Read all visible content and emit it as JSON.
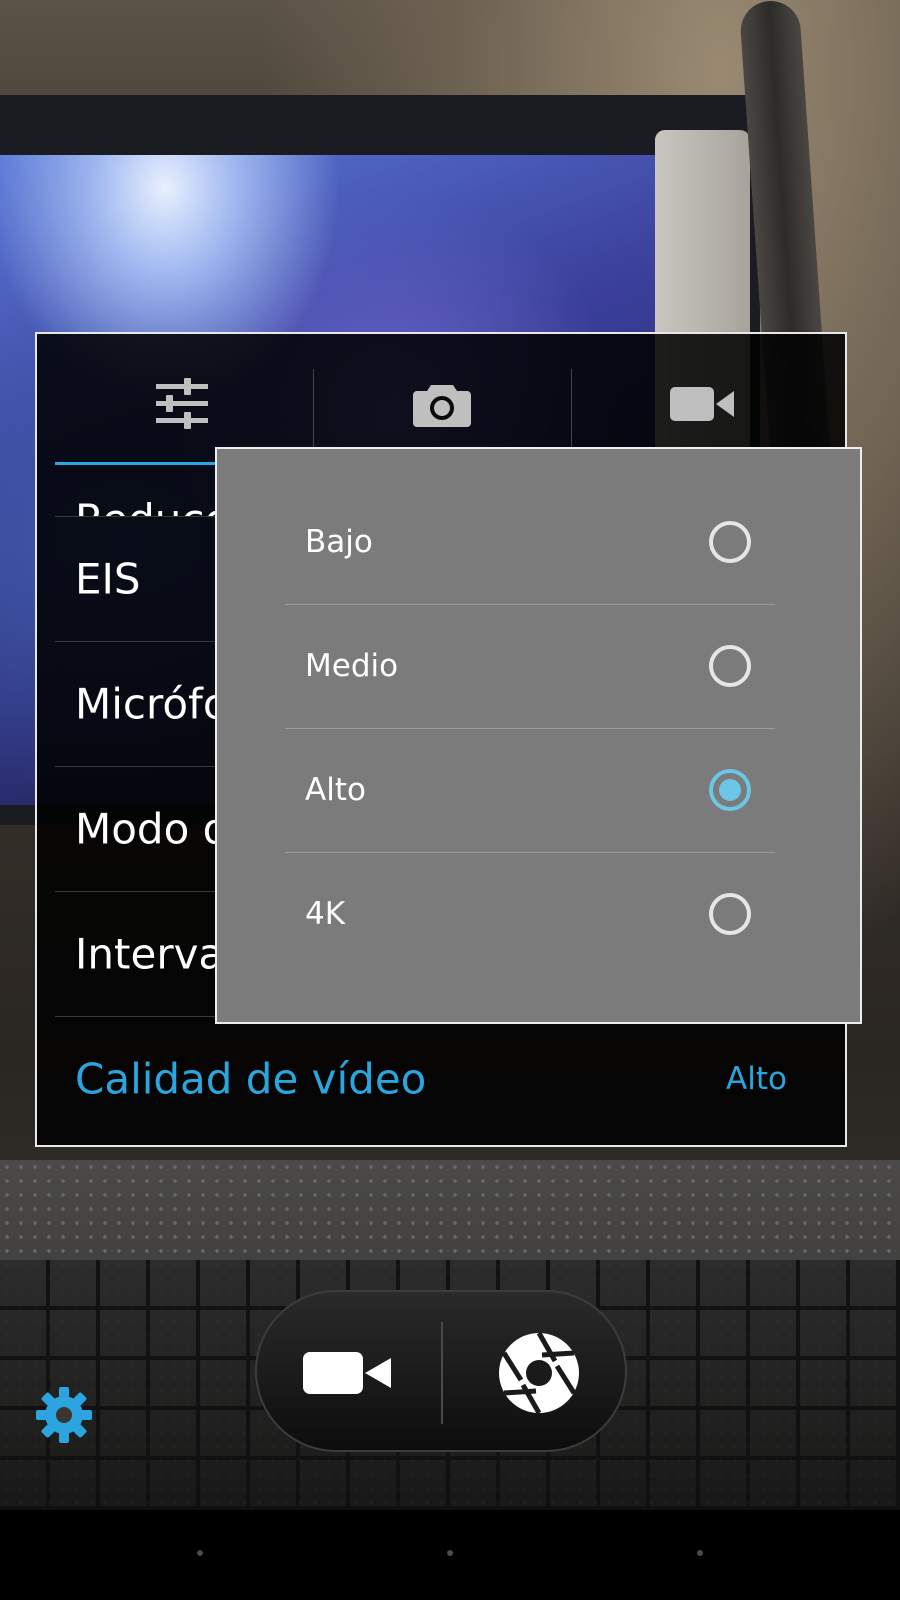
{
  "settings": {
    "tabs": [
      {
        "icon": "sliders-icon"
      },
      {
        "icon": "camera-icon"
      },
      {
        "icon": "video-camera-icon"
      }
    ],
    "items": [
      {
        "label": "Reducc"
      },
      {
        "label": "EIS"
      },
      {
        "label": "Micrófo"
      },
      {
        "label": "Modo d"
      },
      {
        "label": "Interval"
      }
    ],
    "active_item": {
      "label": "Calidad de vídeo",
      "value": "Alto"
    }
  },
  "quality_dialog": {
    "options": [
      {
        "label": "Bajo",
        "selected": false
      },
      {
        "label": "Medio",
        "selected": false
      },
      {
        "label": "Alto",
        "selected": true
      },
      {
        "label": "4K",
        "selected": false
      }
    ]
  },
  "controls": {
    "video_icon": "video-camera-icon",
    "shutter_icon": "shutter-icon",
    "settings_icon": "gear-icon"
  },
  "colors": {
    "accent": "#29a6de",
    "radio_selected": "#6cc6e6",
    "dialog_bg": "#7b7b7b"
  }
}
